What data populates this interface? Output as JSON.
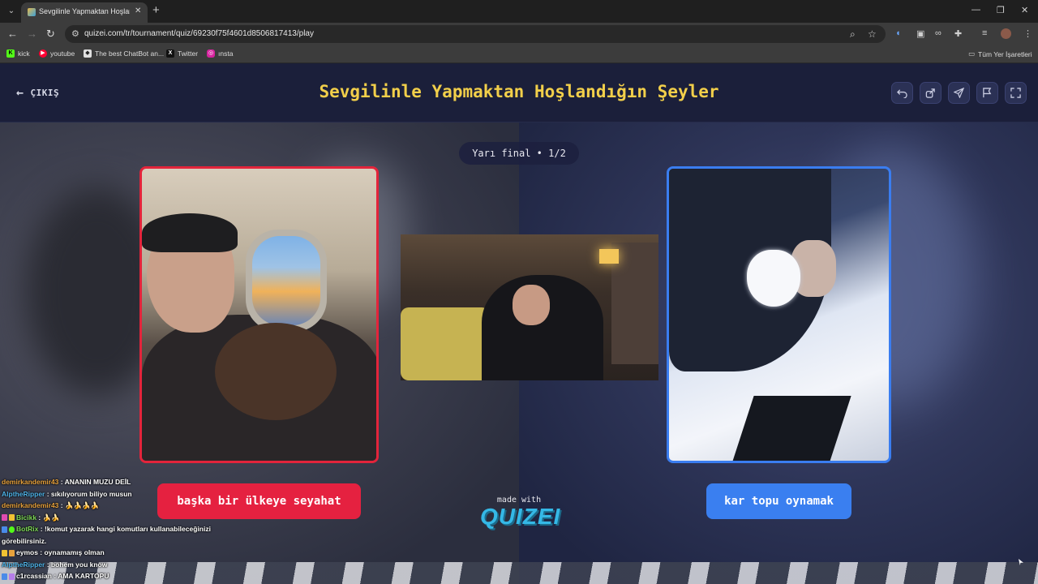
{
  "browser": {
    "tab_title": "Sevgilinle Yapmaktan Hoşlandığın Şeyler",
    "url": "quizei.com/tr/tournament/quiz/69230f75f4601d8506817413/play",
    "bookmarks": [
      {
        "label": "kick",
        "icon": "kick-icon",
        "color": "#53fc18"
      },
      {
        "label": "youtube",
        "icon": "youtube-icon",
        "color": "#ff0033"
      },
      {
        "label": "The best ChatBot an...",
        "icon": "chatbot-icon",
        "color": "#e0e0e0"
      },
      {
        "label": "Twitter",
        "icon": "x-icon",
        "color": "#000000"
      },
      {
        "label": "ınsta",
        "icon": "instagram-icon",
        "color": "#d6249f"
      }
    ],
    "all_bookmarks_label": "Tüm Yer İşaretleri"
  },
  "header": {
    "exit_label": "ÇIKIŞ",
    "title": "Sevgilinle Yapmaktan Hoşlandığın Şeyler",
    "title_color": "#f2cf4a",
    "icons": [
      "undo-icon",
      "share-icon",
      "send-icon",
      "flag-icon",
      "fullscreen-icon"
    ]
  },
  "round": {
    "label": "Yarı final • 1/2"
  },
  "options": {
    "left_label": "başka bir ülkeye seyahat",
    "left_color": "#e52140",
    "right_label": "kar topu oynamak",
    "right_color": "#3a7ff0"
  },
  "brand": {
    "made_with": "made with",
    "name": "QUIZEI"
  },
  "chat": [
    {
      "user": "demirkandemir43",
      "user_color": "#e8a23c",
      "text": " : ANANIN MUZU DEİL"
    },
    {
      "user": "AlptheRipper",
      "user_color": "#4fb3e8",
      "text": " : sıkılıyorum biliyo musun"
    },
    {
      "user": "demirkandemir43",
      "user_color": "#e8a23c",
      "text": " : 🍌🍌🍌🍌"
    },
    {
      "user": "Bicikk",
      "user_color": "#7ed957",
      "text": " : 🍌🍌"
    },
    {
      "user": "BotRix",
      "user_color": "#7ed957",
      "text": " : !komut yazarak hangi komutları kullanabileceğinizi görebilirsiniz."
    },
    {
      "user": "eymos",
      "user_color": "#ffffff",
      "text": " : oynamamış olman"
    },
    {
      "user": "AlptheRipper",
      "user_color": "#4fb3e8",
      "text": " : bohem you know"
    },
    {
      "user": "c1rcassian",
      "user_color": "#ffffff",
      "text": " : AMA KARTOPU"
    }
  ]
}
